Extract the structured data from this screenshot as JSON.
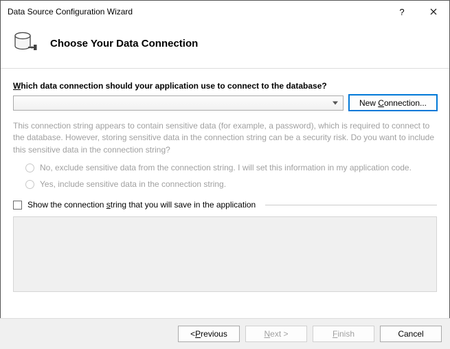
{
  "titlebar": {
    "title": "Data Source Configuration Wizard"
  },
  "header": {
    "heading": "Choose Your Data Connection"
  },
  "form": {
    "question_prefix": "W",
    "question_rest": "hich data connection should your application use to connect to the database?",
    "combo_value": "",
    "new_connection_btn": "New Connection...",
    "info_text": "This connection string appears to contain sensitive data (for example, a password), which is required to connect to the database. However, storing sensitive data in the connection string can be a security risk. Do you want to include this sensitive data in the connection string?",
    "radio_no": "No, exclude sensitive data from the connection string. I will set this information in my application code.",
    "radio_yes": "Yes, include sensitive data in the connection string.",
    "show_string_prefix": "Show the connection ",
    "show_string_u": "s",
    "show_string_rest": "tring that you will save in the application",
    "connection_string": ""
  },
  "footer": {
    "previous": "< Previous",
    "next": "Next >",
    "finish": "Finish",
    "cancel": "Cancel"
  }
}
